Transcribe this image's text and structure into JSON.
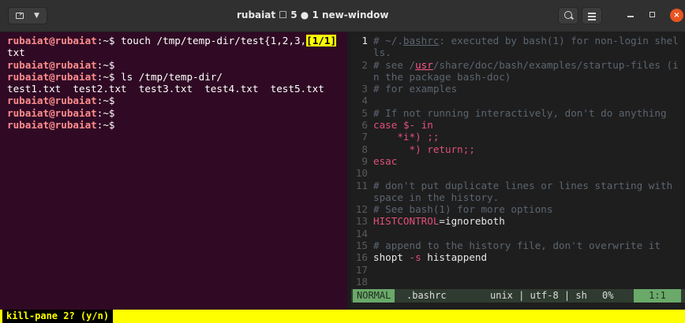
{
  "window": {
    "title": "rubaiat",
    "title_session": "5",
    "title_window": "1 new-window",
    "title_tmux_glyph": "☐",
    "title_dot": "●",
    "close_glyph": "×"
  },
  "left_pane": {
    "lines": [
      {
        "user": "rubaiat@rubaiat",
        "rest": ":~$ touch /tmp/temp-dir/test{1,2,3,",
        "selection": "[1/1]"
      },
      {
        "text": "txt"
      },
      {
        "user": "rubaiat@rubaiat",
        "rest": ":~$"
      },
      {
        "user": "rubaiat@rubaiat",
        "rest": ":~$ ls /tmp/temp-dir/"
      },
      {
        "text": "test1.txt  test2.txt  test3.txt  test4.txt  test5.txt"
      },
      {
        "user": "rubaiat@rubaiat",
        "rest": ":~$"
      },
      {
        "user": "rubaiat@rubaiat",
        "rest": ":~$"
      },
      {
        "user": "rubaiat@rubaiat",
        "rest": ":~$"
      }
    ]
  },
  "vim": {
    "lines": [
      {
        "num": "1",
        "cur": true,
        "segments": [
          {
            "cls": "cmt",
            "t": "# ~/."
          },
          {
            "cls": "cmt-u",
            "t": "bashrc"
          },
          {
            "cls": "cmt",
            "t": ": executed by bash(1) for non-login shel"
          }
        ]
      },
      {
        "num": "",
        "segments": [
          {
            "cls": "cmt",
            "t": "ls."
          }
        ]
      },
      {
        "num": "2",
        "segments": [
          {
            "cls": "cmt",
            "t": "# see /"
          },
          {
            "cls": "path-u",
            "t": "usr"
          },
          {
            "cls": "cmt",
            "t": "/share/doc/bash/examples/startup-files (i"
          }
        ]
      },
      {
        "num": "",
        "segments": [
          {
            "cls": "cmt",
            "t": "n the package bash-doc)"
          }
        ]
      },
      {
        "num": "3",
        "segments": [
          {
            "cls": "cmt",
            "t": "# for examples"
          }
        ]
      },
      {
        "num": "4",
        "segments": []
      },
      {
        "num": "5",
        "segments": [
          {
            "cls": "cmt",
            "t": "# If not running interactively, don't do anything"
          }
        ]
      },
      {
        "num": "6",
        "segments": [
          {
            "cls": "kw",
            "t": "case"
          },
          {
            "cls": "plain",
            "t": " "
          },
          {
            "cls": "ident",
            "t": "$-"
          },
          {
            "cls": "plain",
            "t": " "
          },
          {
            "cls": "kw",
            "t": "in"
          }
        ]
      },
      {
        "num": "7",
        "segments": [
          {
            "cls": "plain",
            "t": "    "
          },
          {
            "cls": "ident",
            "t": "*i*)"
          },
          {
            "cls": "plain",
            "t": " "
          },
          {
            "cls": "kw",
            "t": ";;"
          }
        ]
      },
      {
        "num": "8",
        "segments": [
          {
            "cls": "plain",
            "t": "      "
          },
          {
            "cls": "ident",
            "t": "*)"
          },
          {
            "cls": "plain",
            "t": " "
          },
          {
            "cls": "kw",
            "t": "return;;"
          }
        ]
      },
      {
        "num": "9",
        "segments": [
          {
            "cls": "kw",
            "t": "esac"
          }
        ]
      },
      {
        "num": "10",
        "segments": []
      },
      {
        "num": "11",
        "segments": [
          {
            "cls": "cmt",
            "t": "# don't put duplicate lines or lines starting with"
          }
        ]
      },
      {
        "num": "",
        "segments": [
          {
            "cls": "cmt",
            "t": "space in the history."
          }
        ]
      },
      {
        "num": "12",
        "segments": [
          {
            "cls": "cmt",
            "t": "# See bash(1) for more options"
          }
        ]
      },
      {
        "num": "13",
        "segments": [
          {
            "cls": "ident",
            "t": "HISTCONTROL"
          },
          {
            "cls": "plain",
            "t": "=ignoreboth"
          }
        ]
      },
      {
        "num": "14",
        "segments": []
      },
      {
        "num": "15",
        "segments": [
          {
            "cls": "cmt",
            "t": "# append to the history file, don't overwrite it"
          }
        ]
      },
      {
        "num": "16",
        "segments": [
          {
            "cls": "plain",
            "t": "shopt "
          },
          {
            "cls": "ident",
            "t": "-s"
          },
          {
            "cls": "plain",
            "t": " histappend"
          }
        ]
      },
      {
        "num": "17",
        "segments": []
      },
      {
        "num": "18",
        "segments": []
      }
    ],
    "status": {
      "mode": "NORMAL",
      "file": ".bashrc",
      "encoding": "unix | utf-8 | sh",
      "percent": "0%",
      "position": "1:1"
    }
  },
  "tmux": {
    "prompt": "kill-pane 2? (y/n)"
  },
  "colors": {
    "pane_bg": "#300a24",
    "prompt_user": "#ff8d8d",
    "selection": "#ffff00",
    "vim_bg": "#1e1e1e",
    "tmux_bar": "#ffff00"
  },
  "icons": {
    "terminal": "terminal-icon",
    "search": "search-icon",
    "menu": "hamburger-menu-icon",
    "minimize": "minimize-icon",
    "maximize": "maximize-icon",
    "close": "close-icon"
  }
}
